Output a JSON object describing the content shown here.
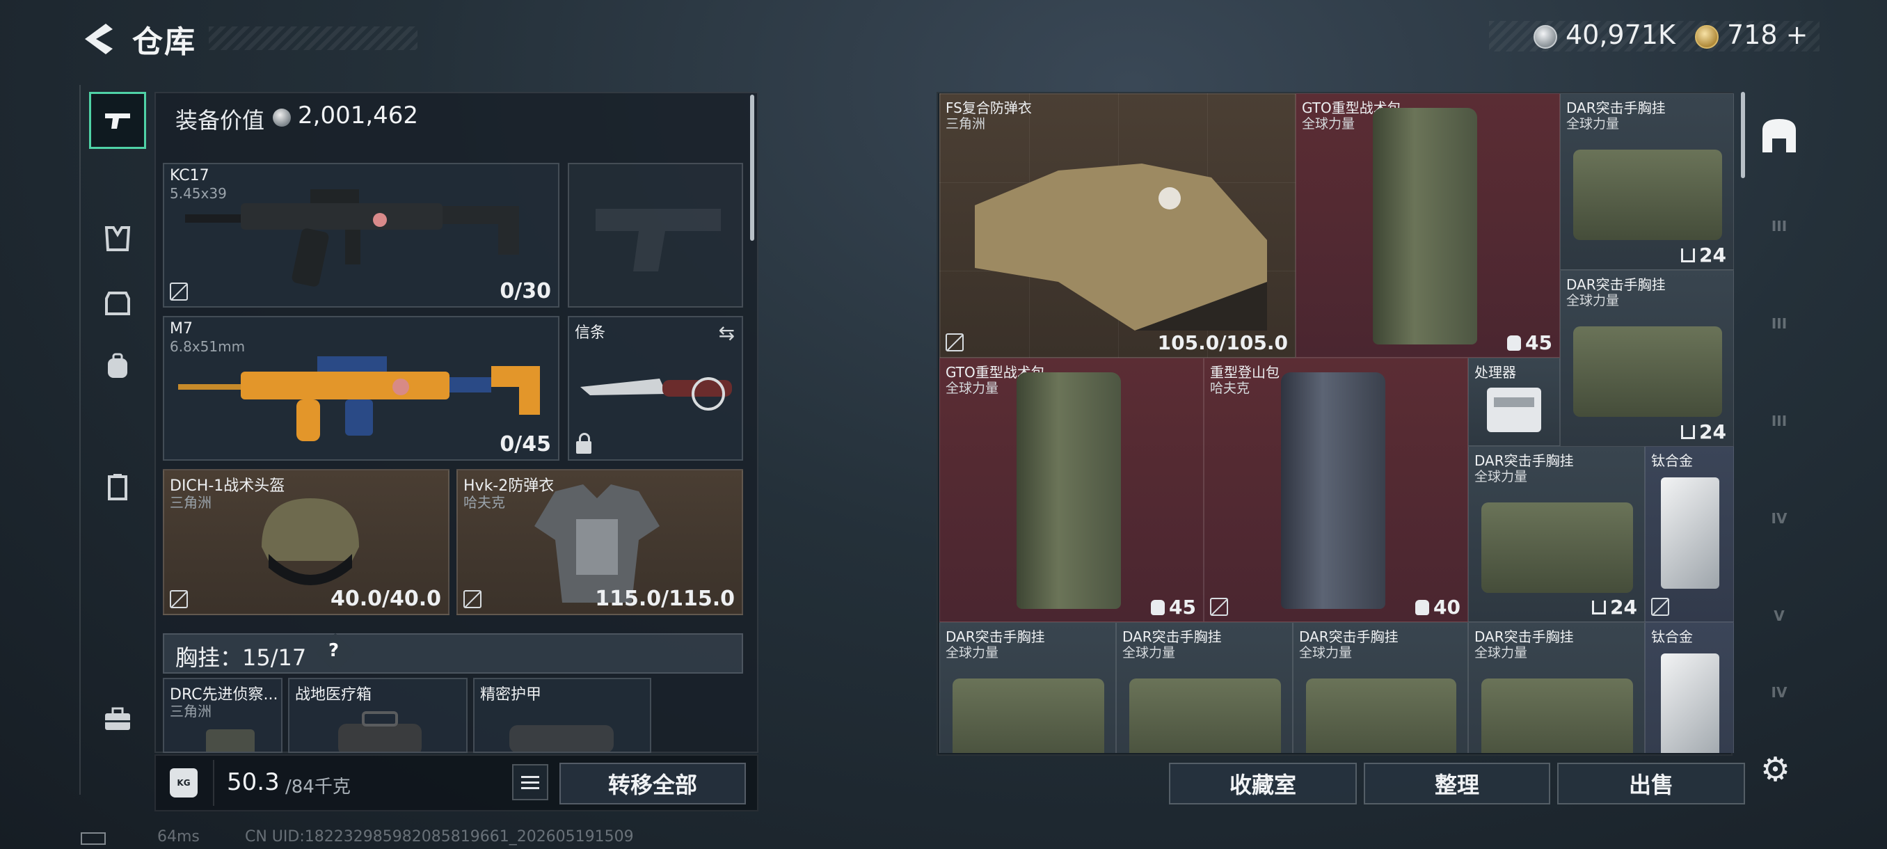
{
  "header": {
    "title": "仓库"
  },
  "currency": {
    "coins": "40,971K",
    "gems": "718",
    "gems_plus": "+"
  },
  "left_panel": {
    "value_label": "装备价值",
    "value_amount": "2,001,462",
    "slots": {
      "primary1": {
        "name": "KC17",
        "caliber": "5.45x39",
        "ammo": "0/30"
      },
      "primary2": {
        "name": "M7",
        "caliber": "6.8x51mm",
        "ammo": "0/45"
      },
      "melee": {
        "name": "信条"
      },
      "helmet": {
        "name": "DICH-1战术头盔",
        "maker": "三角洲",
        "durability": "40.0/40.0"
      },
      "armor": {
        "name": "Hvk-2防弹衣",
        "maker": "哈夫克",
        "durability": "115.0/115.0"
      }
    },
    "chest_rig": {
      "label": "胸挂：",
      "capacity": "15/17",
      "help": "?"
    },
    "chest_items": [
      {
        "name": "DRC先进侦察...",
        "maker": "三角洲"
      },
      {
        "name": "战地医疗箱"
      },
      {
        "name": "精密护甲"
      }
    ],
    "weight": {
      "current": "50.3",
      "max": "/84千克",
      "icon_label": "KG"
    },
    "transfer_all": "转移全部"
  },
  "storage": {
    "items": [
      {
        "name": "FS复合防弹衣",
        "maker": "三角洲",
        "value": "105.0/105.0"
      },
      {
        "name": "GTO重型战术包",
        "maker": "全球力量",
        "value": "45"
      },
      {
        "name": "DAR突击手胸挂",
        "maker": "全球力量",
        "value": "24"
      },
      {
        "name": "DAR突击手胸挂",
        "maker": "全球力量",
        "value": "24"
      },
      {
        "name": "GTO重型战术包",
        "maker": "全球力量",
        "value": "45"
      },
      {
        "name": "重型登山包",
        "maker": "哈夫克",
        "value": "40"
      },
      {
        "name": "处理器"
      },
      {
        "name": "DAR突击手胸挂",
        "maker": "全球力量",
        "value": "24"
      },
      {
        "name": "钛合金"
      },
      {
        "name": "DAR突击手胸挂",
        "maker": "全球力量"
      },
      {
        "name": "DAR突击手胸挂",
        "maker": "全球力量"
      },
      {
        "name": "DAR突击手胸挂",
        "maker": "全球力量"
      },
      {
        "name": "DAR突击手胸挂",
        "maker": "全球力量"
      },
      {
        "name": "钛合金"
      }
    ],
    "buttons": {
      "collection": "收藏室",
      "sort": "整理",
      "sell": "出售"
    },
    "tiers": [
      "III",
      "III",
      "III",
      "IV",
      "V",
      "IV"
    ]
  },
  "status": {
    "ping": "64ms",
    "uid": "CN UID:182232985982085819661_202605191509"
  },
  "colors": {
    "accent": "#4fd2a6",
    "storage_red": "#5b2d34",
    "storage_tan": "#4b3f34"
  }
}
